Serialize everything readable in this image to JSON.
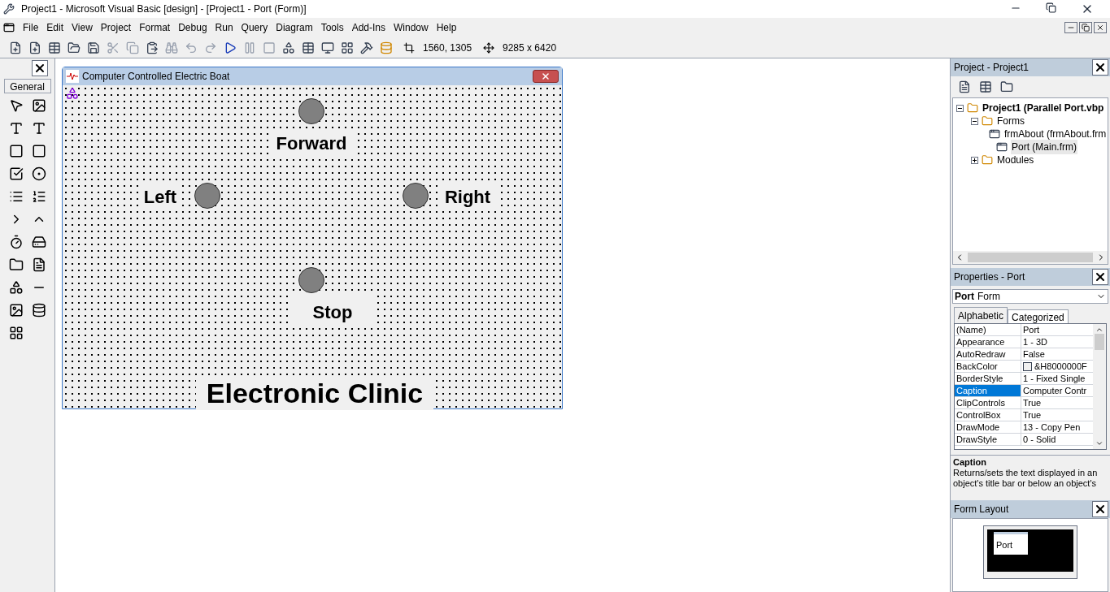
{
  "window": {
    "title": "Project1 - Microsoft Visual Basic [design] - [Project1 - Port (Form)]"
  },
  "menu": [
    "File",
    "Edit",
    "View",
    "Project",
    "Format",
    "Debug",
    "Run",
    "Query",
    "Diagram",
    "Tools",
    "Add-Ins",
    "Window",
    "Help"
  ],
  "toolbar": {
    "position": "1560, 1305",
    "size": "9285 x 6420"
  },
  "toolbox": {
    "tab": "General"
  },
  "form": {
    "title": "Computer Controlled Electric Boat",
    "labels": [
      "Forward",
      "Left",
      "Right",
      "Stop",
      "Electronic Clinic"
    ]
  },
  "project": {
    "title": "Project - Project1",
    "tree": [
      {
        "label": "Project1 (Parallel Port.vbp",
        "bold": true,
        "expanded": true,
        "children": [
          {
            "label": "Forms",
            "expanded": true,
            "children": [
              {
                "label": "frmAbout (frmAbout.frm",
                "selected": false
              },
              {
                "label": "Port (Main.frm)",
                "selected": true
              }
            ]
          },
          {
            "label": "Modules",
            "expanded": false
          }
        ]
      }
    ]
  },
  "properties": {
    "title": "Properties - Port",
    "object_name": "Port",
    "object_type": "Form",
    "tabs": [
      {
        "label": "Alphabetic",
        "selected": true
      },
      {
        "label": "Categorized",
        "selected": false
      }
    ],
    "rows": [
      {
        "name": "(Name)",
        "value": "Port",
        "selected": false
      },
      {
        "name": "Appearance",
        "value": "1 - 3D",
        "selected": false
      },
      {
        "name": "AutoRedraw",
        "value": "False",
        "selected": false
      },
      {
        "name": "BackColor",
        "value": "&H8000000F",
        "selected": false,
        "kind": "color"
      },
      {
        "name": "BorderStyle",
        "value": "1 - Fixed Single",
        "selected": false
      },
      {
        "name": "Caption",
        "value": "Computer Contr",
        "selected": true
      },
      {
        "name": "ClipControls",
        "value": "True",
        "selected": false
      },
      {
        "name": "ControlBox",
        "value": "True",
        "selected": false
      },
      {
        "name": "DrawMode",
        "value": "13 - Copy Pen",
        "selected": false
      },
      {
        "name": "DrawStyle",
        "value": "0 - Solid",
        "selected": false
      }
    ],
    "description_title": "Caption",
    "description": "Returns/sets the text displayed in an object's title bar or below an object's"
  },
  "form_layout": {
    "title": "Form Layout",
    "form_label": "Port"
  }
}
